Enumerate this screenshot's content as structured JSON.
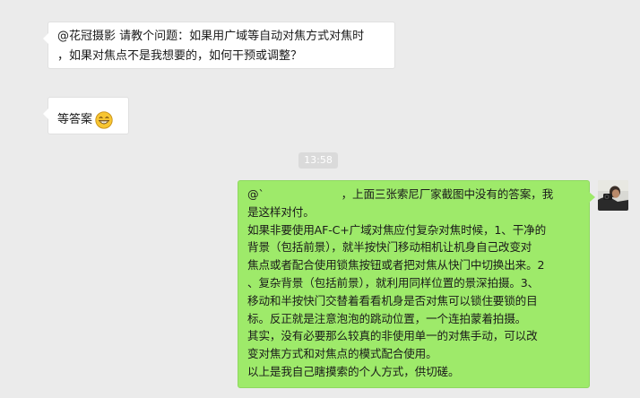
{
  "messages": [
    {
      "side": "left",
      "lines": [
        "@花冠摄影 请教个问题：如果用广域等自动对焦方式对焦时",
        "，如果对焦点不是我想要的，如何干预或调整？"
      ]
    },
    {
      "side": "left",
      "text": "等答案",
      "emoji": "grinning-face-icon"
    },
    {
      "side": "right",
      "mention_prefix": "@`",
      "lines_first_tail": "，上面三张索尼厂家截图中没有的答案，我",
      "lines": [
        "是这样对付。",
        "如果非要使用AF-C+广域对焦应付复杂对焦时候，1、干净的",
        "背景（包括前景），就半按快门移动相机让机身自己改变对",
        "焦点或者配合使用锁焦按钮或者把对焦从快门中切换出来。2",
        "、复杂背景（包括前景），就利用同样位置的景深拍摄。3、",
        "移动和半按快门交替着看看机身是否对焦可以锁住要锁的目",
        "标。反正就是注意泡泡的跳动位置，一个连拍蒙着拍摄。",
        "其实，没有必要那么较真的非使用单一的对焦手动，可以改",
        "变对焦方式和对焦点的模式配合使用。",
        "以上是我自己瞎摸索的个人方式，供切磋。"
      ]
    }
  ],
  "timestamp": "13:58",
  "colors": {
    "background": "#ebebeb",
    "incoming_bubble": "#ffffff",
    "outgoing_bubble": "#9eea6a",
    "timestamp_bg": "#dadada"
  }
}
